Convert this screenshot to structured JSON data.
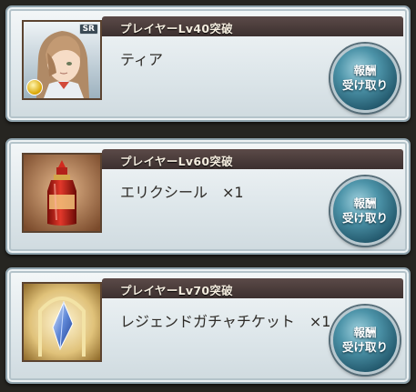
{
  "rewards": [
    {
      "header": "プレイヤーLv40突破",
      "name": "ティア",
      "claim_line1": "報酬",
      "claim_line2": "受け取り",
      "rarity": "SR",
      "thumbnail_icon": "character-portrait-icon"
    },
    {
      "header": "プレイヤーLv60突破",
      "name": "エリクシール　×1",
      "claim_line1": "報酬",
      "claim_line2": "受け取り",
      "thumbnail_icon": "elixir-bottle-icon"
    },
    {
      "header": "プレイヤーLv70突破",
      "name": "レジェンドガチャチケット　×1",
      "claim_line1": "報酬",
      "claim_line2": "受け取り",
      "thumbnail_icon": "gacha-ticket-crystal-icon"
    }
  ]
}
